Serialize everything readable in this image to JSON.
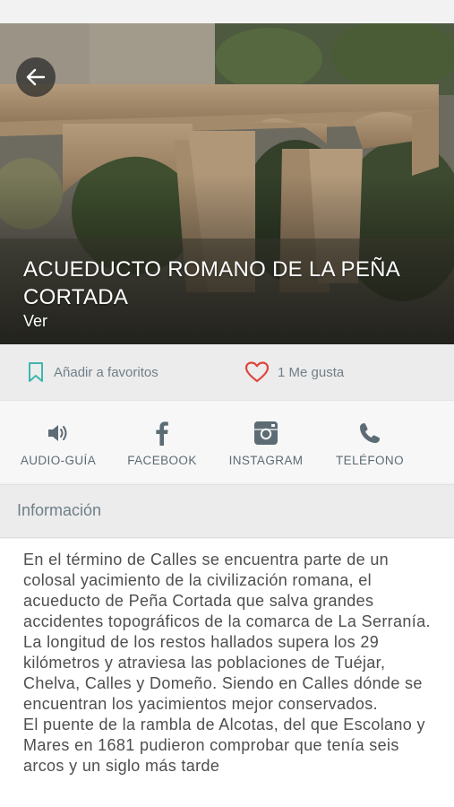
{
  "place": {
    "title": "ACUEDUCTO ROMANO DE LA PEÑA CORTADA",
    "subtitle": "Ver"
  },
  "favorites_bar": {
    "bookmark_label": "Añadir a favoritos",
    "like_label": "1 Me gusta"
  },
  "actions": [
    {
      "label": "AUDIO-GUÍA",
      "icon": "speaker-icon"
    },
    {
      "label": "FACEBOOK",
      "icon": "facebook-icon"
    },
    {
      "label": "INSTAGRAM",
      "icon": "instagram-icon"
    },
    {
      "label": "TELÉFONO",
      "icon": "phone-icon"
    }
  ],
  "info_section": {
    "heading": "Información",
    "body": "En el término de Calles se encuentra parte de un colosal yacimiento de la civilización romana, el acueducto de Peña Cortada que salva grandes accidentes topográficos de la comarca de La Serranía.\nLa longitud de los restos hallados supera los 29 kilómetros y atraviesa las poblaciones de Tuéjar, Chelva, Calles y Domeño. Siendo en Calles dónde se encuentran los yacimientos mejor conservados.\nEl puente de la rambla de Alcotas, del que Escolano y Mares en 1681 pudieron comprobar que tenía seis arcos y un siglo más tarde"
  },
  "colors": {
    "accent_teal": "#3fb6ad",
    "heart_red": "#e0443e",
    "icon_gray": "#5c6b74"
  }
}
